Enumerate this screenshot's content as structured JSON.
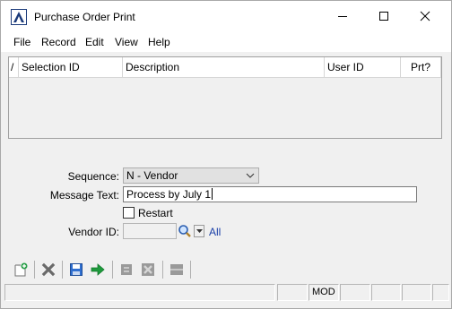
{
  "window": {
    "title": "Purchase Order Print",
    "app_logo_icon": "sage-logo-icon",
    "controls": {
      "minimize_icon": "minimize-icon",
      "maximize_icon": "maximize-icon",
      "close_icon": "close-icon"
    }
  },
  "menu": {
    "items": [
      "File",
      "Record",
      "Edit",
      "View",
      "Help"
    ]
  },
  "grid": {
    "sort_indicator": "/",
    "columns": [
      "Selection ID",
      "Description",
      "User ID",
      "Prt?"
    ],
    "rows": []
  },
  "form": {
    "sequence": {
      "label": "Sequence:",
      "value": "N - Vendor"
    },
    "message_text": {
      "label": "Message Text:",
      "value": "Process by July 1"
    },
    "restart": {
      "label": "Restart",
      "checked": false
    },
    "vendor_id": {
      "label": "Vendor ID:",
      "value": "",
      "lookup_icon": "magnifier-icon",
      "all_link": "All"
    }
  },
  "toolbar": {
    "buttons": [
      {
        "name": "new-record-button",
        "icon": "new-document-icon",
        "enabled": true
      },
      {
        "name": "delete-button",
        "icon": "delete-x-icon",
        "enabled": true
      },
      {
        "name": "save-button",
        "icon": "save-disk-icon",
        "enabled": true
      },
      {
        "name": "proceed-button",
        "icon": "green-arrow-icon",
        "enabled": true
      },
      {
        "name": "print-button",
        "icon": "print-icon",
        "enabled": false
      },
      {
        "name": "delete-all-button",
        "icon": "delete-all-icon",
        "enabled": false
      },
      {
        "name": "lines-button",
        "icon": "lines-icon",
        "enabled": false
      }
    ]
  },
  "statusbar": {
    "cells": [
      "",
      "",
      "MOD",
      "",
      "",
      "",
      ""
    ]
  },
  "colors": {
    "window_bg": "#f0f0f0",
    "link": "#1a3fa8",
    "green_arrow": "#1e9a3c",
    "save_blue": "#2f6fd0"
  }
}
